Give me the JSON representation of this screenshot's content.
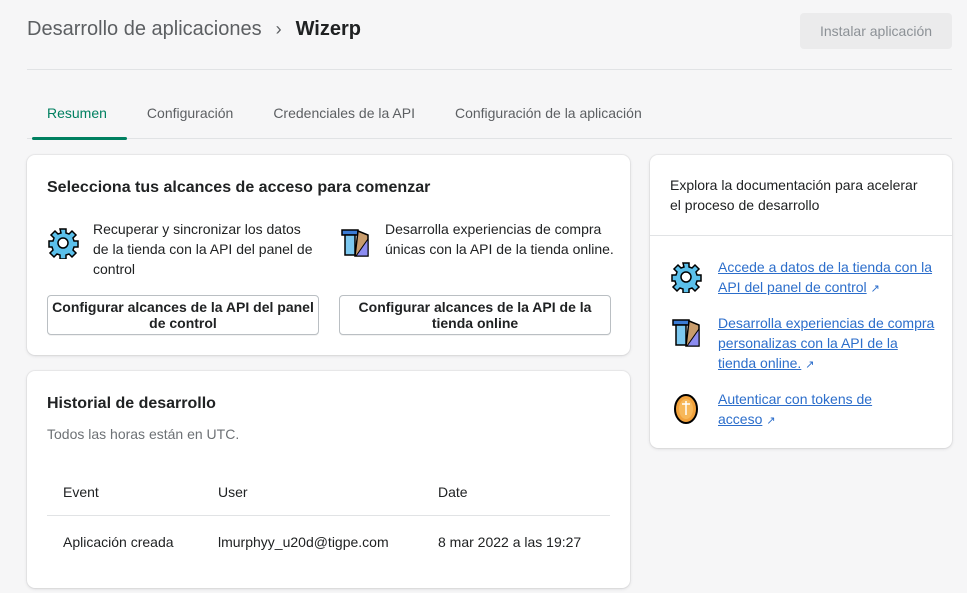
{
  "header": {
    "breadcrumb": "Desarrollo de aplicaciones",
    "title": "Wizerp",
    "install_button": "Instalar aplicación"
  },
  "tabs": [
    {
      "label": "Resumen",
      "active": true
    },
    {
      "label": "Configuración"
    },
    {
      "label": "Credenciales de la API"
    },
    {
      "label": "Configuración de la aplicación"
    }
  ],
  "scopes": {
    "title": "Selecciona tus alcances de acceso para comenzar",
    "items": [
      {
        "icon": "gear-icon",
        "text": "Recuperar y sincronizar los datos de la tienda con la API del panel de control",
        "button": "Configurar alcances de la API del panel de control"
      },
      {
        "icon": "storefront-pillar-icon",
        "text": "Desarrolla experiencias de compra únicas con la API de la tienda online.",
        "button": "Configurar alcances de la API de la tienda online"
      }
    ]
  },
  "history": {
    "title": "Historial de desarrollo",
    "subtitle": "Todos las horas están en UTC.",
    "columns": [
      "Event",
      "User",
      "Date"
    ],
    "rows": [
      [
        "Aplicación creada",
        "lmurphyy_u20d@tigpe.com",
        "8 mar 2022 a las 19:27"
      ]
    ]
  },
  "docs": {
    "intro": "Explora la documentación para acelerar el proceso de desarrollo",
    "links": [
      {
        "icon": "gear-icon",
        "text": "Accede a datos de la tienda con la API del panel de control"
      },
      {
        "icon": "storefront-pillar-icon",
        "text": "Desarrolla experiencias de compra personalizas con la API de la tienda online."
      },
      {
        "icon": "coin-icon",
        "text": "Autenticar con tokens de acceso"
      }
    ]
  },
  "colors": {
    "accent": "#008060",
    "link": "#2c6ecb"
  }
}
